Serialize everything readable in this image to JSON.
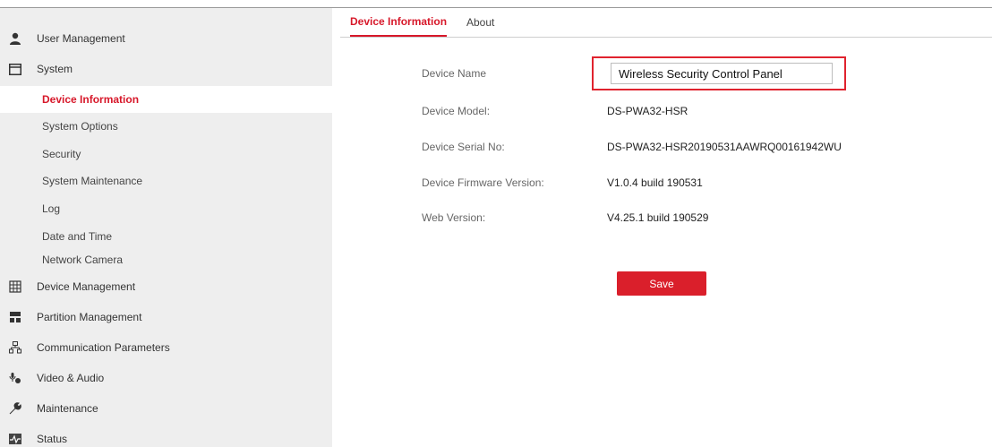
{
  "sidebar": {
    "user_management": "User Management",
    "system": "System",
    "system_sub": [
      "Device Information",
      "System Options",
      "Security",
      "System Maintenance",
      "Log",
      "Date and Time",
      "Network Camera"
    ],
    "device_management": "Device Management",
    "partition_management": "Partition Management",
    "communication_parameters": "Communication Parameters",
    "video_audio": "Video & Audio",
    "maintenance": "Maintenance",
    "status": "Status"
  },
  "tabs": {
    "device_information": "Device Information",
    "about": "About"
  },
  "form": {
    "device_name_label": "Device Name",
    "device_name_value": "Wireless Security Control Panel",
    "device_model_label": "Device Model:",
    "device_model_value": "DS-PWA32-HSR",
    "serial_label": "Device Serial No:",
    "serial_value": "DS-PWA32-HSR20190531AAWRQ00161942WU",
    "firmware_label": "Device Firmware Version:",
    "firmware_value": "V1.0.4 build 190531",
    "web_label": "Web Version:",
    "web_value": "V4.25.1 build 190529",
    "save_label": "Save"
  },
  "colors": {
    "accent": "#da1f2b",
    "sidebar_bg": "#eeeeee",
    "active_text": "#d7182a"
  }
}
